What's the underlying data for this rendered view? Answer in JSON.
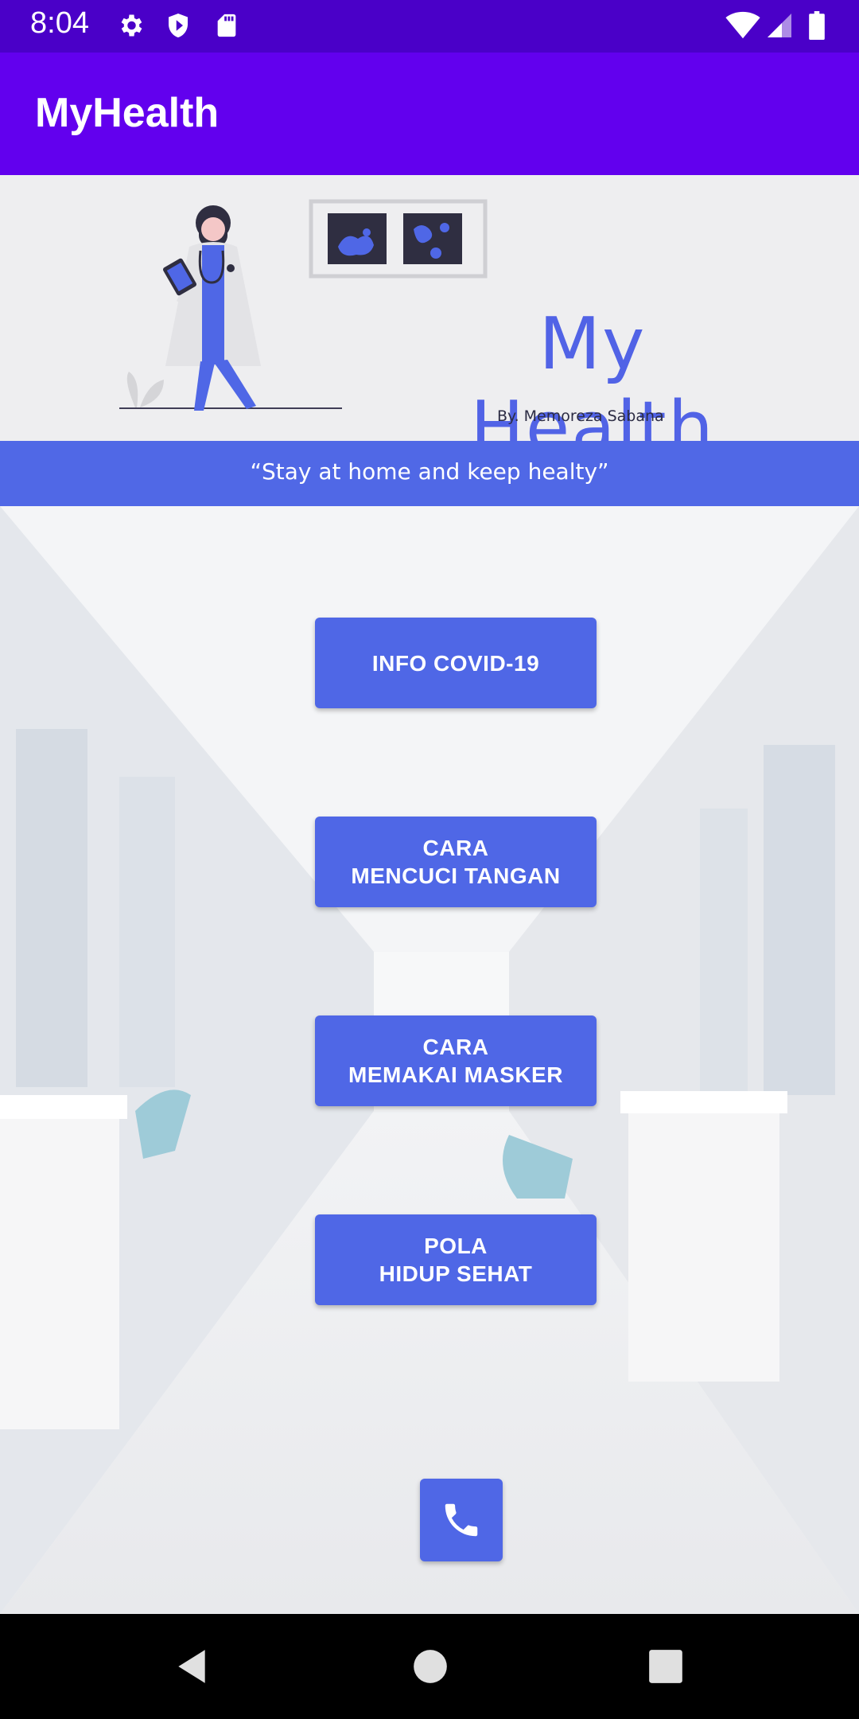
{
  "status_bar": {
    "time": "8:04",
    "left_icons": [
      "gear-icon",
      "shield-icon",
      "sd-card-icon"
    ],
    "right_icons": [
      "wifi-icon",
      "cell-signal-icon",
      "battery-icon"
    ]
  },
  "app_bar": {
    "title": "MyHealth"
  },
  "banner": {
    "title": "My Health",
    "author": "By. Memoreza Sabana",
    "quote": "“Stay at home and keep healty”"
  },
  "menu": {
    "buttons": [
      {
        "line1": "INFO COVID-19",
        "line2": ""
      },
      {
        "line1": "CARA",
        "line2": "MENCUCI TANGAN"
      },
      {
        "line1": "CARA",
        "line2": "MEMAKAI MASKER"
      },
      {
        "line1": "POLA",
        "line2": "HIDUP SEHAT"
      }
    ],
    "call_icon": "phone-icon"
  },
  "nav_bar": {
    "icons": [
      "back-icon",
      "home-icon",
      "recents-icon"
    ]
  },
  "colors": {
    "status_bar": "#4a00c8",
    "app_bar": "#6200ee",
    "accent": "#4f67e6",
    "banner_bg": "#eeeef0"
  }
}
